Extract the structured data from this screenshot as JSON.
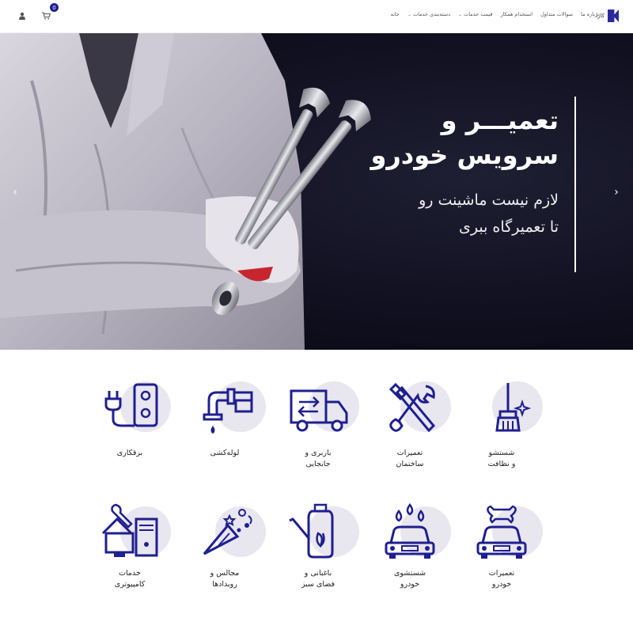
{
  "header": {
    "logo_text": "کارا",
    "cart_count": "0",
    "nav": [
      {
        "label": "خانه",
        "has_dropdown": false
      },
      {
        "label": "دسته‌بندی خدمات",
        "has_dropdown": true
      },
      {
        "label": "قیمت خدمات",
        "has_dropdown": true
      },
      {
        "label": "استخدام همکار",
        "has_dropdown": false
      },
      {
        "label": "سوالات متداول",
        "has_dropdown": false
      },
      {
        "label": "درباره ما",
        "has_dropdown": false
      }
    ]
  },
  "hero": {
    "title_line1": "تعمیـــر و",
    "title_line2": "سرویس خودرو",
    "subtitle_line1": "لازم نیست ماشینت رو",
    "subtitle_line2": "تا تعمیرگاه ببری"
  },
  "services": {
    "row1": [
      {
        "label": "شستشو\nو نظافت",
        "icon": "broom-icon"
      },
      {
        "label": "تعمیرات\nساختمان",
        "icon": "tools-icon"
      },
      {
        "label": "باربری و\nجابجایی",
        "icon": "truck-icon"
      },
      {
        "label": "لوله‌کشی",
        "icon": "faucet-icon"
      },
      {
        "label": "برقکاری",
        "icon": "plug-icon"
      }
    ],
    "row2": [
      {
        "label": "تعمیرات\nخودرو",
        "icon": "car-wrench-icon"
      },
      {
        "label": "شستشوی\nخودرو",
        "icon": "car-wash-icon"
      },
      {
        "label": "باغبانی و\nفضای سبز",
        "icon": "watering-can-icon"
      },
      {
        "label": "مجالس و\nرویدادها",
        "icon": "party-icon"
      },
      {
        "label": "خدمات\nکامپیوتری",
        "icon": "computer-icon"
      }
    ]
  },
  "colors": {
    "accent": "#1f1f8f",
    "icon_blob": "#e8e6ef",
    "hero_bg": "#101020"
  }
}
